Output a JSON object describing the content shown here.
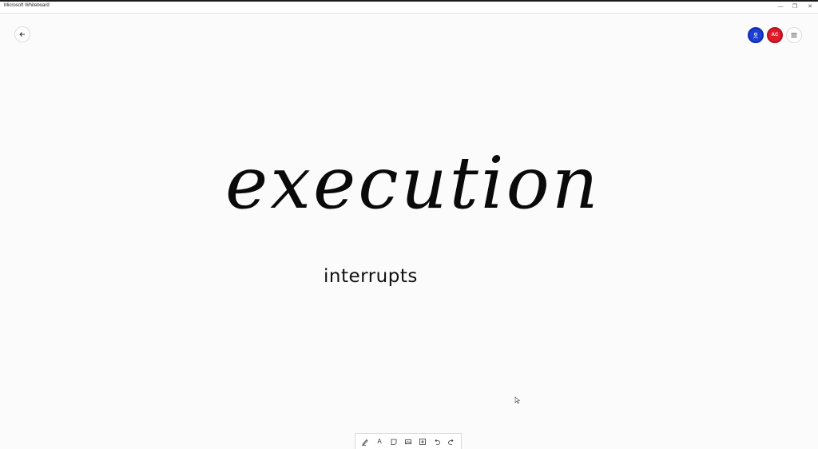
{
  "window": {
    "title": "Microsoft Whiteboard",
    "controls": {
      "minimize": "—",
      "maximize": "❐",
      "close": "✕"
    }
  },
  "header": {
    "back_icon": "arrow-left-icon",
    "participants": [
      {
        "initials": "",
        "color": "#1d3fd6",
        "icon": "person-icon"
      },
      {
        "initials": "AC",
        "color": "#e01b2a"
      }
    ],
    "menu_icon": "hamburger-menu-icon"
  },
  "canvas": {
    "ink": [
      {
        "text": "execution"
      },
      {
        "text": "interrupts"
      }
    ]
  },
  "toolbar": {
    "tools": [
      {
        "name": "pen",
        "icon": "pen-icon"
      },
      {
        "name": "text",
        "icon": "text-icon",
        "glyph": "A"
      },
      {
        "name": "note",
        "icon": "note-icon"
      },
      {
        "name": "image",
        "icon": "image-icon"
      },
      {
        "name": "insert",
        "icon": "insert-icon"
      },
      {
        "name": "undo",
        "icon": "undo-icon"
      },
      {
        "name": "redo",
        "icon": "redo-icon"
      }
    ]
  }
}
